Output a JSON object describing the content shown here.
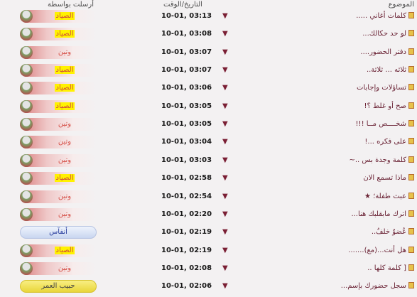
{
  "header": {
    "topic": "الموضوع",
    "date": "التاريخ/الوقت",
    "sender": "أرسلت بواسطة"
  },
  "rows": [
    {
      "topic": "كلمات أغاني .....",
      "date": "10-01, 03:13",
      "sender": "الصياد",
      "style": "red",
      "highlight": true
    },
    {
      "topic": "لو حد حكالك...",
      "date": "10-01, 03:08",
      "sender": "الصياد",
      "style": "red",
      "highlight": true
    },
    {
      "topic": "دفتر الحضور....",
      "date": "10-01, 03:07",
      "sender": "وتين",
      "style": "red",
      "highlight": false
    },
    {
      "topic": "ثلاثه ... ثلاثة..",
      "date": "10-01, 03:07",
      "sender": "الصياد",
      "style": "red",
      "highlight": true
    },
    {
      "topic": "تساؤلات وإجابات",
      "date": "10-01, 03:06",
      "sender": "الصياد",
      "style": "red",
      "highlight": true
    },
    {
      "topic": "صح أو غلط ؟!",
      "date": "10-01, 03:05",
      "sender": "الصياد",
      "style": "red",
      "highlight": true
    },
    {
      "topic": "شخــــص مــا !!!",
      "date": "10-01, 03:05",
      "sender": "وتين",
      "style": "red",
      "highlight": false
    },
    {
      "topic": "على فكره ...!",
      "date": "10-01, 03:04",
      "sender": "وتين",
      "style": "red",
      "highlight": false
    },
    {
      "topic": "كلمة وجدة بس ..~",
      "date": "10-01, 03:03",
      "sender": "وتين",
      "style": "red",
      "highlight": false
    },
    {
      "topic": "ماذا تسمع الان",
      "date": "10-01, 02:58",
      "sender": "الصياد",
      "style": "red",
      "highlight": true
    },
    {
      "topic": "عبث طفلة؛ ★",
      "date": "10-01, 02:54",
      "sender": "وتين",
      "style": "red",
      "highlight": false
    },
    {
      "topic": "اترك مابقلبك هنا...",
      "date": "10-01, 02:20",
      "sender": "وتين",
      "style": "red",
      "highlight": false
    },
    {
      "topic": "عُضوٌ خلفٌ..",
      "date": "10-01, 02:19",
      "sender": "أنفآس",
      "style": "blue",
      "highlight": false
    },
    {
      "topic": "هل أنت...(مع).......",
      "date": "10-01, 02:19",
      "sender": "الصياد",
      "style": "red",
      "highlight": true
    },
    {
      "topic": "[ كلمة كلها ..",
      "date": "10-01, 02:08",
      "sender": "وتين",
      "style": "red",
      "highlight": false
    },
    {
      "topic": "سجل حضورك بإسم...",
      "date": "10-01, 02:06",
      "sender": "حبيب العمر",
      "style": "yellow",
      "highlight": false
    }
  ],
  "icons": {
    "topic": "folder-icon",
    "arrow": "last-post-arrow-icon",
    "avatar": "user-avatar-icon"
  },
  "colors": {
    "topic_text": "#6b2436",
    "arrow": "#7a1f34",
    "highlight": "#fff200",
    "blue_name": "#2b3f9e"
  }
}
